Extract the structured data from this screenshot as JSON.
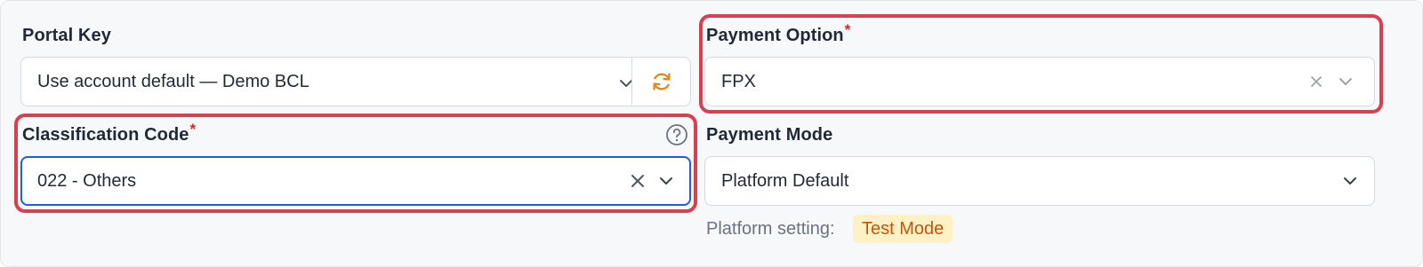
{
  "portal_key": {
    "label": "Portal Key",
    "value": "Use account default — Demo BCL",
    "icons": {
      "dropdown": "chevron-down-icon",
      "refresh": "refresh-icon"
    },
    "refresh_color": "#e0891b"
  },
  "classification_code": {
    "label": "Classification Code",
    "required_marker": "*",
    "value": "022 - Others",
    "icons": {
      "help": "help-circle-icon",
      "clear": "close-icon",
      "dropdown": "chevron-down-icon"
    },
    "focus_color": "#1d5fe0"
  },
  "payment_option": {
    "label": "Payment Option",
    "required_marker": "*",
    "value": "FPX",
    "icons": {
      "clear": "close-icon",
      "dropdown": "chevron-down-icon"
    }
  },
  "payment_mode": {
    "label": "Payment Mode",
    "value": "Platform Default",
    "icons": {
      "dropdown": "chevron-down-icon"
    },
    "platform_setting_label": "Platform setting:",
    "platform_setting_value": "Test Mode"
  },
  "colors": {
    "highlight_border": "#d7404e",
    "required_asterisk": "#dc2626",
    "badge_bg": "#fdf1c5",
    "badge_text": "#c2570c"
  }
}
